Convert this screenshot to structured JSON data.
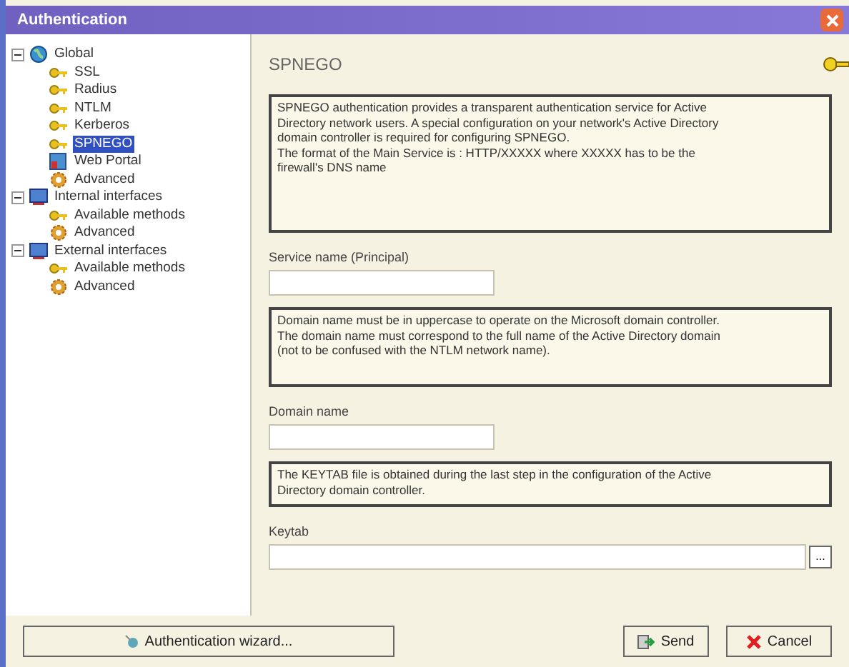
{
  "window": {
    "title": "Authentication"
  },
  "tree": [
    {
      "label": "Global",
      "kind": "globe",
      "expanded": true,
      "selected": false,
      "children": [
        {
          "label": "SSL",
          "kind": "key",
          "selected": false
        },
        {
          "label": "Radius",
          "kind": "key",
          "selected": false
        },
        {
          "label": "NTLM",
          "kind": "key",
          "selected": false
        },
        {
          "label": "Kerberos",
          "kind": "key",
          "selected": false
        },
        {
          "label": "SPNEGO",
          "kind": "key",
          "selected": true
        },
        {
          "label": "Web Portal",
          "kind": "portal",
          "selected": false
        },
        {
          "label": "Advanced",
          "kind": "gear",
          "selected": false
        }
      ]
    },
    {
      "label": "Internal interfaces",
      "kind": "network",
      "expanded": true,
      "selected": false,
      "children": [
        {
          "label": "Available methods",
          "kind": "key",
          "selected": false
        },
        {
          "label": "Advanced",
          "kind": "gear",
          "selected": false
        }
      ]
    },
    {
      "label": "External interfaces",
      "kind": "network",
      "expanded": true,
      "selected": false,
      "children": [
        {
          "label": "Available methods",
          "kind": "key",
          "selected": false
        },
        {
          "label": "Advanced",
          "kind": "gear",
          "selected": false
        }
      ]
    }
  ],
  "panel": {
    "title": "SPNEGO",
    "sections": [
      {
        "kind": "note",
        "lines": [
          "SPNEGO authentication provides a transparent authentication service for Active",
          "Directory network users. A special configuration on your network's Active Directory",
          "domain controller is required for configuring SPNEGO.",
          "The format of the Main Service is : HTTP/XXXXX where XXXXX has to be the",
          "firewall's DNS name"
        ]
      },
      {
        "kind": "field",
        "label": "Service name (Principal)"
      },
      {
        "kind": "note",
        "lines": [
          "Domain name must be in uppercase to operate on the Microsoft domain controller.",
          "The domain name must correspond to the full name of the Active Directory domain",
          "(not to be confused with the NTLM network name)."
        ]
      },
      {
        "kind": "field",
        "label": "Domain name"
      },
      {
        "kind": "note",
        "lines": [
          "The KEYTAB file is obtained during the last step in the configuration of the Active",
          "Directory domain controller."
        ]
      },
      {
        "kind": "file",
        "label": "Keytab",
        "browse": "..."
      }
    ]
  },
  "buttons": {
    "wizard": "Authentication wizard...",
    "send": "Send",
    "cancel": "Cancel"
  }
}
